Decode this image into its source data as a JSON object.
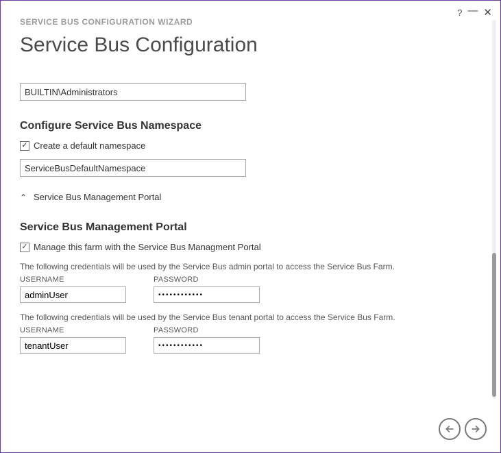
{
  "titlebar": {
    "help": "?",
    "minimize": "—",
    "close": "✕"
  },
  "wizard": {
    "label": "SERVICE BUS CONFIGURATION WIZARD",
    "title": "Service Bus Configuration"
  },
  "admin_group": {
    "value": "BUILTIN\\Administrators"
  },
  "namespace": {
    "heading": "Configure Service Bus Namespace",
    "checkbox_label": "Create a default namespace",
    "checkbox_checked": true,
    "value": "ServiceBusDefaultNamespace"
  },
  "portal": {
    "expander_label": "Service Bus Management Portal",
    "expanded": true,
    "heading": "Service Bus Management Portal",
    "manage_checkbox_label": "Manage this farm with the Service Bus Managment Portal",
    "manage_checkbox_checked": true,
    "admin_desc": "The following credentials will be used by the Service Bus admin portal to access the Service Bus Farm.",
    "tenant_desc": "The following credentials will be used by the Service Bus tenant portal to access the Service Bus Farm.",
    "labels": {
      "username": "USERNAME",
      "password": "PASSWORD"
    },
    "admin": {
      "username": "adminUser",
      "password": "••••••••••••"
    },
    "tenant": {
      "username": "tenantUser",
      "password": "••••••••••••"
    }
  },
  "checkmark": "✓",
  "chevron_up": "⌃"
}
